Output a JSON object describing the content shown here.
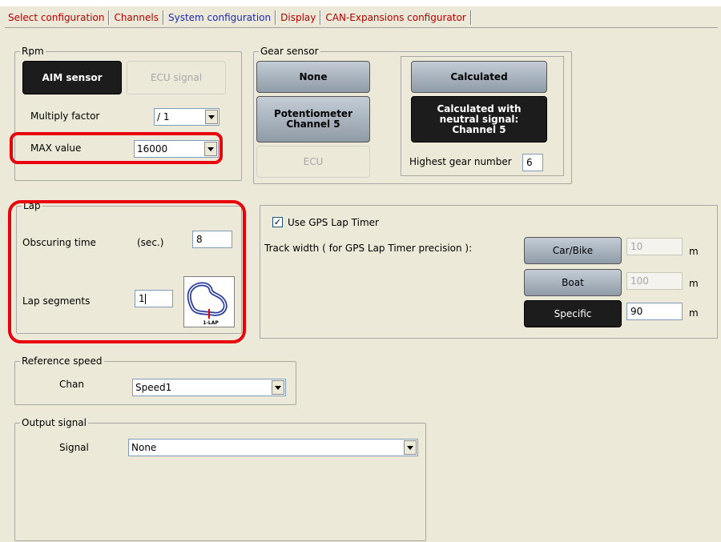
{
  "tabs": [
    {
      "label": "Select configuration"
    },
    {
      "label": "Channels"
    },
    {
      "label": "System configuration"
    },
    {
      "label": "Display"
    },
    {
      "label": "CAN-Expansions configurator"
    }
  ],
  "rpm": {
    "legend": "Rpm",
    "aim_sensor": "AIM sensor",
    "ecu_signal": "ECU signal",
    "multiply_label": "Multiply factor",
    "multiply_value": "/ 1",
    "max_label": "MAX value",
    "max_value": "16000"
  },
  "gear": {
    "legend": "Gear sensor",
    "none": "None",
    "potentiometer_line1": "Potentiometer",
    "potentiometer_line2": "Channel 5",
    "ecu": "ECU",
    "calculated": "Calculated",
    "calc_neutral_line1": "Calculated with",
    "calc_neutral_line2": "neutral signal:",
    "calc_neutral_line3": "Channel 5",
    "highest_label": "Highest gear number",
    "highest_value": "6"
  },
  "lap": {
    "legend": "Lap",
    "obscuring_label": "Obscuring time",
    "obscuring_unit": "(sec.)",
    "obscuring_value": "8",
    "segments_label": "Lap segments",
    "segments_value": "1",
    "track_icon_text": "1-LAP"
  },
  "gps": {
    "use_label": "Use GPS Lap Timer",
    "checked_mark": "✓",
    "track_width_label": "Track width ( for GPS Lap Timer precision ):",
    "car_bike": "Car/Bike",
    "car_bike_value": "10",
    "boat": "Boat",
    "boat_value": "100",
    "specific": "Specific",
    "specific_value": "90",
    "unit": "m"
  },
  "reference_speed": {
    "legend": "Reference speed",
    "chan_label": "Chan",
    "chan_value": "Speed1"
  },
  "output_signal": {
    "legend": "Output signal",
    "signal_label": "Signal",
    "signal_value": "None"
  },
  "colors": {
    "highlight": "#e8000b",
    "tab_text": "#b40000",
    "active_tab": "#1f2ba8"
  }
}
